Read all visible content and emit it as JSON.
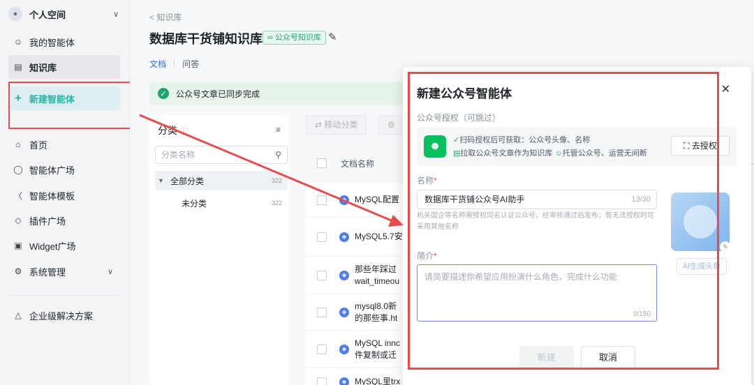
{
  "sidebar": {
    "space_label": "个人空间",
    "items": [
      {
        "label": "我的智能体",
        "icon": "bot-icon"
      },
      {
        "label": "知识库",
        "icon": "document-icon"
      },
      {
        "label": "新建智能体",
        "icon": "plus-icon"
      },
      {
        "label": "首页",
        "icon": "home-icon"
      },
      {
        "label": "智能体广场",
        "icon": "plaza-icon"
      },
      {
        "label": "智能体模板",
        "icon": "template-icon"
      },
      {
        "label": "插件广场",
        "icon": "plugin-icon"
      },
      {
        "label": "Widget广场",
        "icon": "widget-icon"
      },
      {
        "label": "系统管理",
        "icon": "settings-icon"
      },
      {
        "label": "企业级解决方案",
        "icon": "enterprise-icon"
      }
    ]
  },
  "main": {
    "breadcrumb": "知识库",
    "title": "数据库干货铺知识库",
    "tag": "公众号知识库",
    "tabs": [
      "文档",
      "问答"
    ],
    "banner": "公众号文章已同步完成",
    "category": {
      "heading": "分类",
      "search_placeholder": "分类名称",
      "rows": [
        {
          "name": "全部分类",
          "count": "322"
        },
        {
          "name": "未分类",
          "count": "322"
        }
      ]
    },
    "toolbar": {
      "move": "移动分类"
    },
    "docs": {
      "header": "文档名称",
      "rows": [
        "MySQL配置",
        "MySQL5.7安",
        "那些年踩过\nwait_timeou",
        "mysql8.0新\n的那些事.ht",
        "MySQL innc\n件复制或迁",
        "MySQL里trx"
      ]
    }
  },
  "modal": {
    "title": "新建公众号智能体",
    "auth_section": "公众号授权（可跳过）",
    "auth_line1": "扫码授权后可获取：公众号头像、名称",
    "auth_line2a": "拉取公众号文章作为知识库",
    "auth_line2b": "托管公众号、运营无间断",
    "auth_button": "去授权",
    "name_label": "名称",
    "name_value": "数据库干货铺公众号AI助手",
    "name_count": "13/30",
    "hint": "机关国企等名称需授权同名认证公众号，经审核通过后发布；暂无法授权时可采用其他名称",
    "desc_label": "简介",
    "desc_placeholder": "请简要描述你希望应用扮演什么角色，完成什么功能",
    "desc_count": "0/150",
    "ai_avatar": "AI生成头像",
    "create_button": "新建",
    "cancel_button": "取消"
  },
  "colors": {
    "accent": "#2f6fe0",
    "highlight": "#e84b4b",
    "wechat": "#07c160",
    "new_agent": "#2bb3a3"
  }
}
